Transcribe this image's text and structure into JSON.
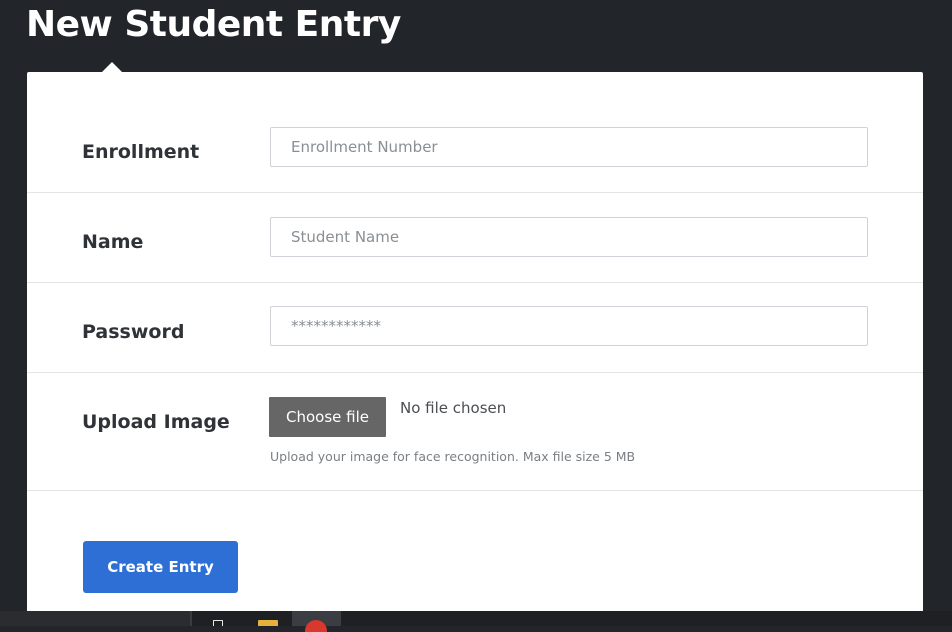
{
  "page": {
    "title": "New Student Entry"
  },
  "form": {
    "enrollment": {
      "label": "Enrollment",
      "placeholder": "Enrollment Number",
      "value": ""
    },
    "name": {
      "label": "Name",
      "placeholder": "Student Name",
      "value": ""
    },
    "password": {
      "label": "Password",
      "placeholder": "************",
      "value": ""
    },
    "upload": {
      "label": "Upload Image",
      "button_label": "Choose file",
      "status": "No file chosen",
      "help": "Upload your image for face recognition. Max file size 5 MB"
    },
    "submit_label": "Create Entry"
  },
  "colors": {
    "background": "#22252a",
    "card": "#ffffff",
    "primary_button": "#2d6fd5",
    "file_button": "#666666"
  },
  "taskbar": {
    "icons": [
      "tablet-icon",
      "folder-icon",
      "chrome-icon"
    ]
  }
}
